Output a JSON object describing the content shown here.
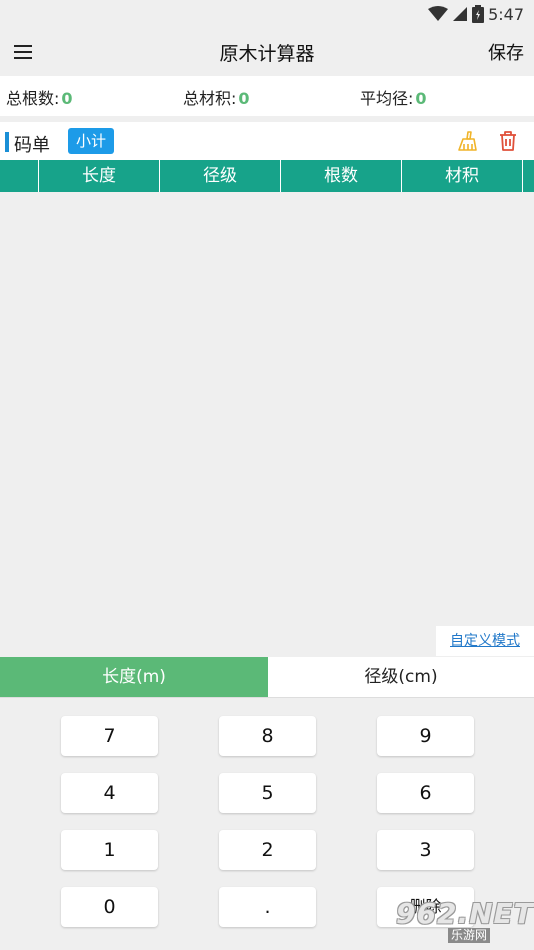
{
  "status_bar": {
    "time": "5:47"
  },
  "app_bar": {
    "title": "原木计算器",
    "save_label": "保存"
  },
  "summary": {
    "total_count_label": "总根数:",
    "total_count_value": "0",
    "total_volume_label": "总材积:",
    "total_volume_value": "0",
    "avg_diameter_label": "平均径:",
    "avg_diameter_value": "0"
  },
  "list": {
    "title": "码单",
    "subtotal_label": "小计"
  },
  "table": {
    "columns": [
      "",
      "长度",
      "径级",
      "根数",
      "材积"
    ]
  },
  "custom_mode_label": "自定义模式",
  "mode_tabs": [
    {
      "label": "长度(m)",
      "active": true
    },
    {
      "label": "径级(cm)",
      "active": false
    }
  ],
  "keypad": {
    "rows": [
      [
        "7",
        "8",
        "9"
      ],
      [
        "4",
        "5",
        "6"
      ],
      [
        "1",
        "2",
        "3"
      ],
      [
        "0",
        ".",
        "删除"
      ]
    ]
  },
  "watermark": {
    "text": "962.NET",
    "subtext": "乐游网"
  },
  "colors": {
    "accent_green": "#5bb977",
    "header_teal": "#17a38a",
    "button_blue": "#1d9be8",
    "delete_red": "#e0503a",
    "broom_yellow": "#f0b429"
  }
}
